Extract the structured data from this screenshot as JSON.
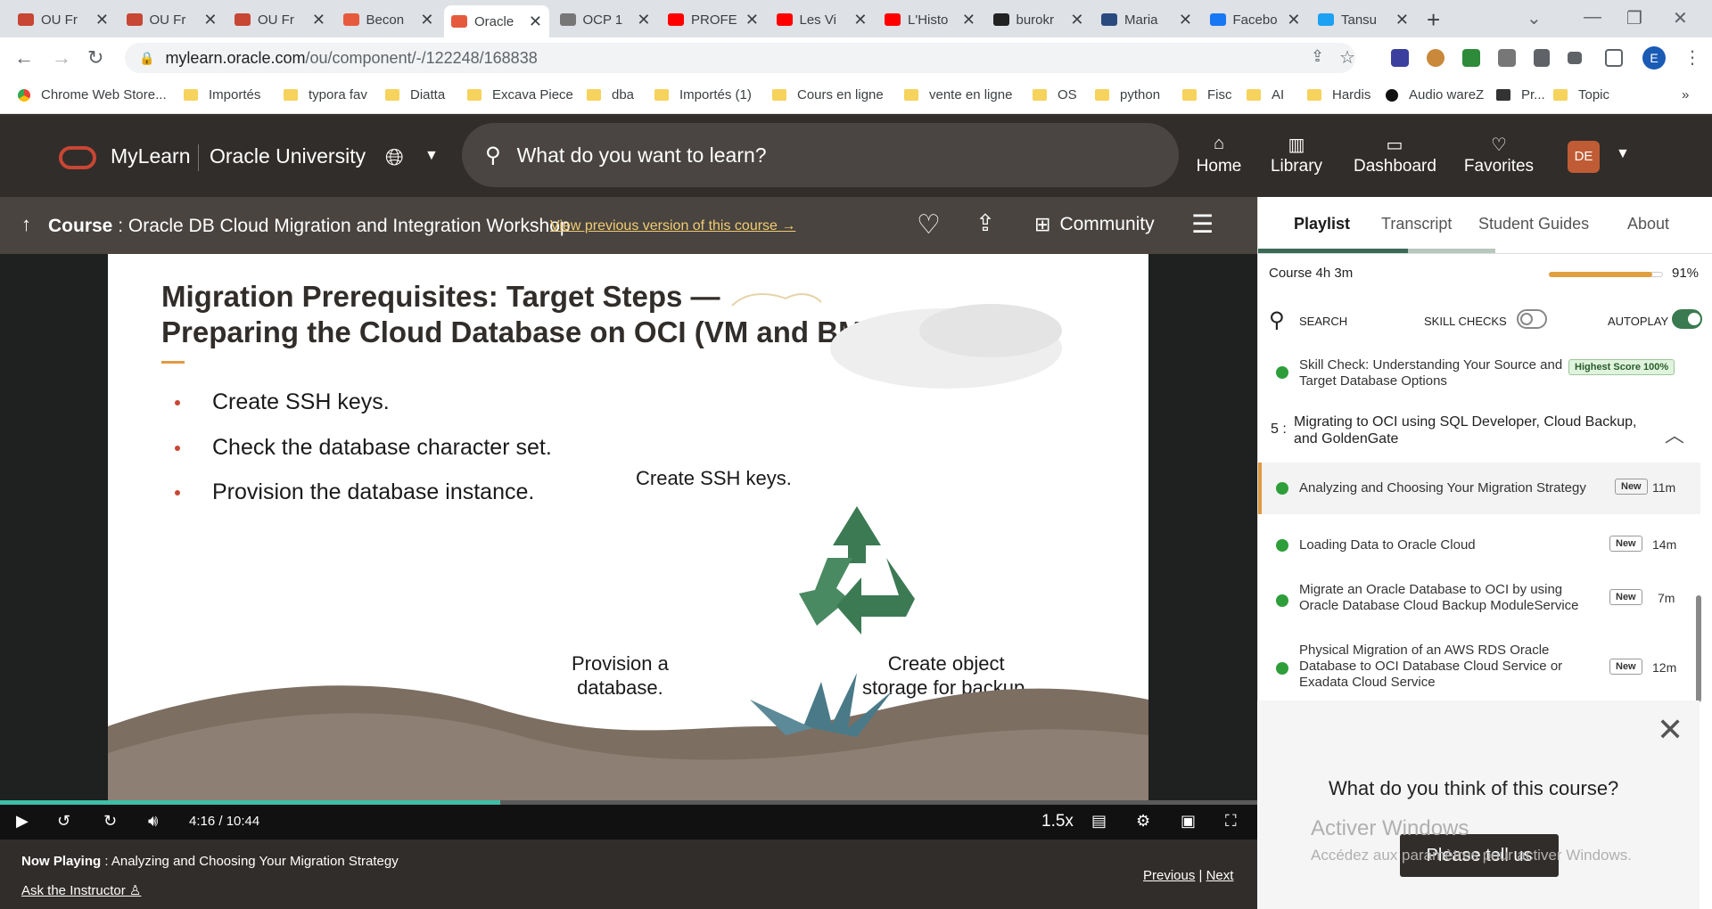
{
  "browser": {
    "tabs": [
      {
        "title": "OU Fr",
        "fav": "#c74634"
      },
      {
        "title": "OU Fr",
        "fav": "#c74634"
      },
      {
        "title": "OU Fr",
        "fav": "#c74634"
      },
      {
        "title": "Becon",
        "fav": "#e55a3c"
      },
      {
        "title": "Oracle",
        "fav": "#e55a3c",
        "active": true
      },
      {
        "title": "OCP 1",
        "fav": "#777"
      },
      {
        "title": "PROFE",
        "fav": "#ff0000"
      },
      {
        "title": "Les Vi",
        "fav": "#ff0000"
      },
      {
        "title": "L'Histo",
        "fav": "#ff0000"
      },
      {
        "title": "burokr",
        "fav": "#222"
      },
      {
        "title": "Maria",
        "fav": "#2a4a7f"
      },
      {
        "title": "Facebo",
        "fav": "#1877f2"
      },
      {
        "title": "Tansu",
        "fav": "#1da1f2"
      }
    ],
    "url_host": "mylearn.oracle.com",
    "url_path": "/ou/component/-/122248/168838",
    "profile_initial": "E",
    "bookmarks": [
      "Chrome Web Store...",
      "Importés",
      "typora fav",
      "Diatta",
      "Excava Piece",
      "dba",
      "Importés (1)",
      "Cours en ligne",
      "vente en ligne",
      "OS",
      "python",
      "Fisc",
      "AI",
      "Hardis",
      "Audio wareZ",
      "Pr...",
      "Topic"
    ]
  },
  "header": {
    "mylearn": "MyLearn",
    "ou": "Oracle University",
    "search_placeholder": "What do you want to learn?",
    "nav": [
      {
        "label": "Home",
        "icon": "home-icon"
      },
      {
        "label": "Library",
        "icon": "library-icon"
      },
      {
        "label": "Dashboard",
        "icon": "dashboard-icon"
      },
      {
        "label": "Favorites",
        "icon": "heart-icon"
      }
    ],
    "avatar": "DE"
  },
  "coursebar": {
    "prefix": "Course",
    "title": " : Oracle DB Cloud Migration and Integration Workshop",
    "prev_version": "View previous version of this course →",
    "community": "Community"
  },
  "slide": {
    "title_line1": "Migration Prerequisites: Target Steps —",
    "title_line2": "Preparing the Cloud Database on OCI (VM and BM)",
    "bullets": [
      "Create SSH keys.",
      "Check the database character set.",
      "Provision the database instance."
    ],
    "diag_top": "Create SSH keys.",
    "diag_left_1": "Provision a",
    "diag_left_2": "database.",
    "diag_right_1": "Create object",
    "diag_right_2": "storage for backup."
  },
  "player": {
    "time": "4:16 / 10:44",
    "speed": "1.5x",
    "progress": 0.398,
    "now_label": "Now Playing",
    "now_title": " : Analyzing and Choosing Your Migration Strategy",
    "ask": "Ask the Instructor",
    "previous": "Previous",
    "next": "Next"
  },
  "side": {
    "tabs": [
      "Playlist",
      "Transcript",
      "Student Guides",
      "About"
    ],
    "course_label": "Course",
    "course_duration": "4h 3m",
    "course_pct": "91%",
    "course_progress": 0.91,
    "search": "SEARCH",
    "skill_checks": "SKILL CHECKS",
    "autoplay": "AUTOPLAY",
    "skill_check_item": "Skill Check: Understanding Your Source and Target Database Options",
    "score_badge": "Highest Score 100%",
    "section_num": "5 :",
    "section_title": "Migrating to OCI using SQL Developer, Cloud Backup, and GoldenGate",
    "items": [
      {
        "title": "Analyzing and Choosing Your Migration Strategy",
        "badge": "New",
        "dur": "11m"
      },
      {
        "title": "Loading Data to Oracle Cloud",
        "badge": "New",
        "dur": "14m"
      },
      {
        "title": "Migrate an Oracle Database to OCI by using Oracle Database Cloud Backup ModuleService",
        "badge": "New",
        "dur": "7m"
      },
      {
        "title": "Physical Migration of an AWS RDS Oracle Database to OCI Database Cloud Service or Exadata Cloud Service",
        "badge": "New",
        "dur": "12m"
      }
    ],
    "feedback_title": "What do you think of this course?",
    "feedback_btn": "Please tell us"
  },
  "watermark": {
    "line1": "Activer Windows",
    "line2": "Accédez aux paramètres pour activer Windows."
  }
}
